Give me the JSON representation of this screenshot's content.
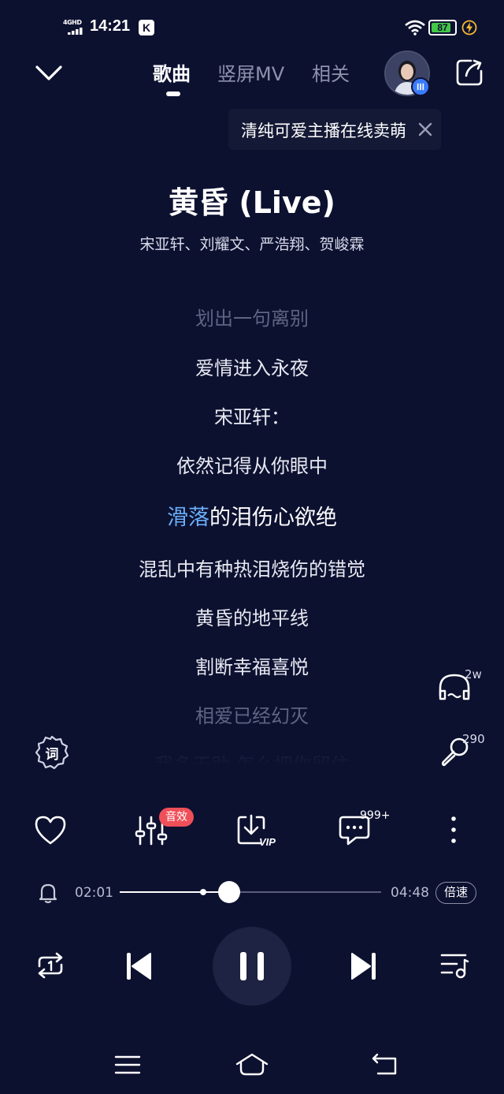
{
  "status_bar": {
    "network": "4GHD",
    "time": "14:21",
    "app_badge": "K",
    "battery_level": 87,
    "battery_text": "87"
  },
  "nav": {
    "tabs": [
      {
        "label": "歌曲",
        "active": true
      },
      {
        "label": "竖屏MV",
        "active": false
      },
      {
        "label": "相关",
        "active": false
      }
    ]
  },
  "promo": {
    "text": "清纯可爱主播在线卖萌"
  },
  "song": {
    "title": "黄昏 (Live)",
    "artists": "宋亚轩、刘耀文、严浩翔、贺峻霖"
  },
  "lyrics": {
    "lines": [
      {
        "text": "划出一句离别",
        "state": "dim"
      },
      {
        "text": "爱情进入永夜",
        "state": "normal"
      },
      {
        "text": "宋亚轩：",
        "state": "normal"
      },
      {
        "text": "依然记得从你眼中",
        "state": "normal"
      },
      {
        "text": "滑落的泪伤心欲绝",
        "state": "current",
        "sung_chars": 2
      },
      {
        "text": "混乱中有种热泪烧伤的错觉",
        "state": "normal"
      },
      {
        "text": "黄昏的地平线",
        "state": "normal"
      },
      {
        "text": "割断幸福喜悦",
        "state": "normal"
      },
      {
        "text": "相爱已经幻灭",
        "state": "dim"
      },
      {
        "text": "我多无助 怎么把你留住",
        "state": "faint"
      }
    ]
  },
  "side": {
    "listen_count": "2w",
    "sing_count": "290",
    "lyric_button_label": "词"
  },
  "actions": {
    "effect_badge": "音效",
    "comment_count": "999+",
    "vip_label": "VIP"
  },
  "progress": {
    "current": "02:01",
    "total": "04:48",
    "played_fraction": 0.42,
    "buffered_fraction": 0.32,
    "speed_label": "倍速"
  },
  "colors": {
    "background": "#0d1130",
    "lyric_highlight": "#6aaef8",
    "badge_red": "#ef4f59",
    "battery_green": "#43c748"
  }
}
